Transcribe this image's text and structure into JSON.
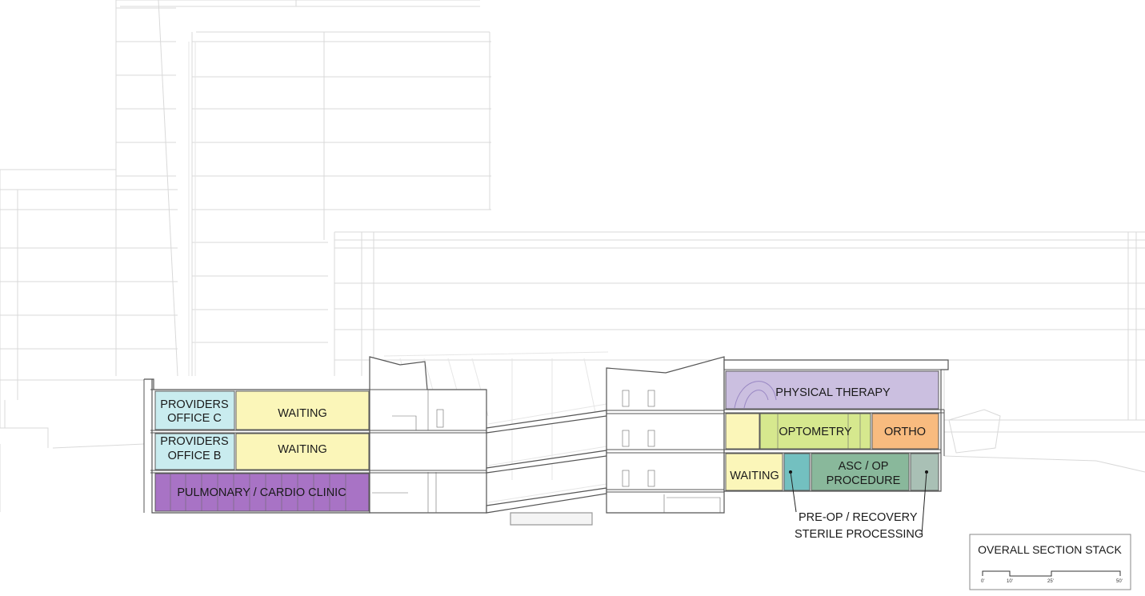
{
  "title": "OVERALL SECTION STACK",
  "scale": {
    "ticks": [
      "0'",
      "10'",
      "25'",
      "50'"
    ]
  },
  "colors": {
    "providers": "#c9ecef",
    "waiting": "#fbf6b9",
    "pulmonary": "#a873c5",
    "physical_therapy": "#cbbfe0",
    "optometry": "#d6e88e",
    "ortho": "#f8bb7f",
    "preop": "#73c0c0",
    "asc": "#89b89b",
    "sterile": "#a9c0b5"
  },
  "rooms": {
    "providers_c": [
      "PROVIDERS",
      "OFFICE C"
    ],
    "waiting_top": "WAITING",
    "providers_b": [
      "PROVIDERS",
      "OFFICE B"
    ],
    "waiting_mid": "WAITING",
    "pulmonary": "PULMONARY / CARDIO CLINIC",
    "physical_therapy": "PHYSICAL THERAPY",
    "optometry": "OPTOMETRY",
    "ortho": "ORTHO",
    "waiting_right": "WAITING",
    "asc": [
      "ASC / OP",
      "PROCEDURE"
    ]
  },
  "callouts": {
    "preop": "PRE-OP / RECOVERY",
    "sterile": "STERILE PROCESSING"
  }
}
